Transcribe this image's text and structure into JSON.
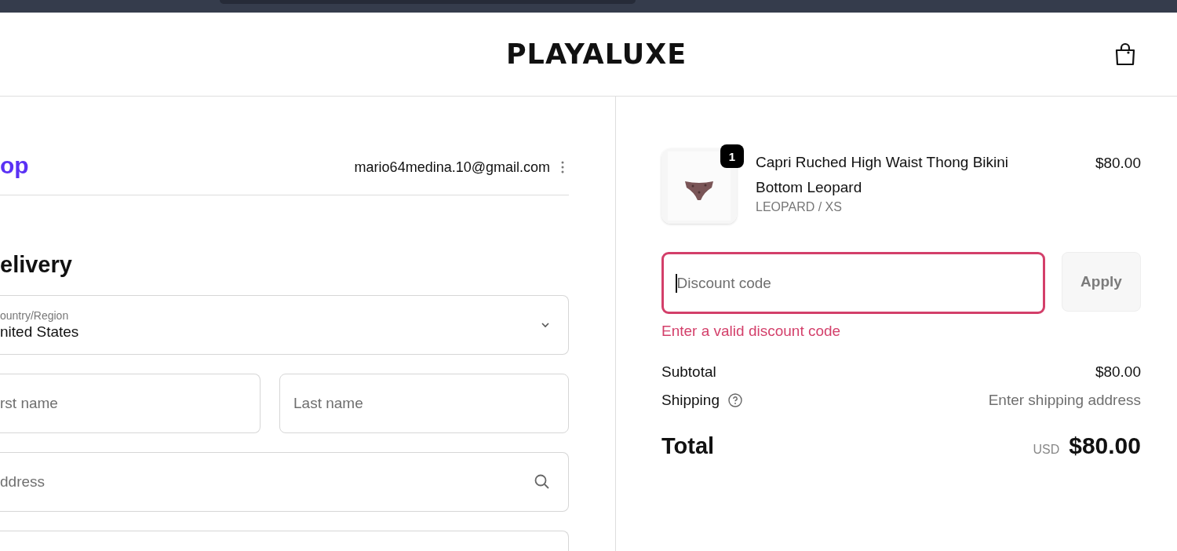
{
  "header": {
    "logo": "PLAYALUXE"
  },
  "account": {
    "shop_logo": "op",
    "email": "mario64medina.10@gmail.com"
  },
  "delivery": {
    "heading": "elivery",
    "fields": [
      {
        "kind": "select",
        "label": "ountry/Region",
        "value": "nited States"
      },
      {
        "kind": "text",
        "placeholder": "rst name"
      },
      {
        "kind": "text",
        "placeholder": "Last name"
      },
      {
        "kind": "search",
        "placeholder": "ddress"
      },
      {
        "kind": "blank"
      }
    ]
  },
  "summary": {
    "item": {
      "quantity": "1",
      "name": "Capri Ruched High Waist Thong Bikini Bottom Leopard",
      "variant": "LEOPARD / XS",
      "price": "$80.00"
    },
    "discount": {
      "placeholder": "Discount code",
      "invalid": true,
      "error": "Enter a valid discount code",
      "button": "Apply"
    },
    "lines": [
      {
        "kind": "plain",
        "label": "Subtotal",
        "value": "$80.00"
      },
      {
        "kind": "help",
        "label": "Shipping",
        "value": "Enter shipping address"
      }
    ],
    "total": {
      "label": "Total",
      "currency": "USD",
      "value": "$80.00"
    }
  }
}
